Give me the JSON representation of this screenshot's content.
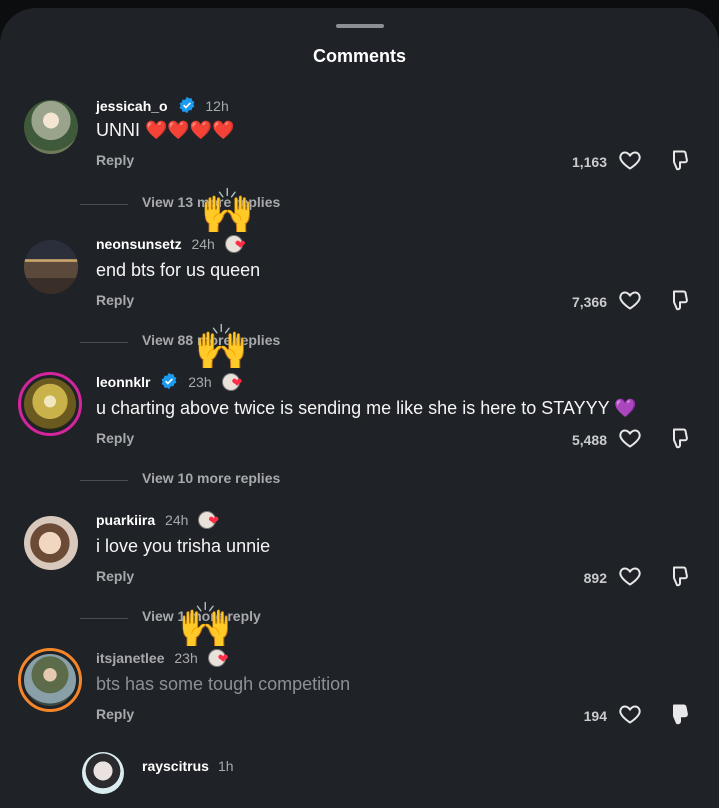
{
  "header": {
    "title": "Comments"
  },
  "reply_label": "Reply",
  "comments": [
    {
      "username": "jessicah_o",
      "verified": true,
      "time": "12h",
      "text": "UNNI ❤️❤️❤️❤️",
      "likes": "1,163",
      "view_more": "View 13 more replies",
      "dim": false
    },
    {
      "username": "neonsunsetz",
      "verified": false,
      "time": "24h",
      "text": "end bts for us queen",
      "likes": "7,366",
      "view_more": "View 88 more replies",
      "dim": false
    },
    {
      "username": "leonnklr",
      "verified": true,
      "time": "23h",
      "text": "u charting above twice is sending me like she is here to STAYYY 💜",
      "likes": "5,488",
      "view_more": "View 10 more replies",
      "dim": false
    },
    {
      "username": "puarkiira",
      "verified": false,
      "time": "24h",
      "text": "i love you trisha unnie",
      "likes": "892",
      "view_more": "View 1 more reply",
      "dim": false
    },
    {
      "username": "itsjanetlee",
      "verified": false,
      "time": "23h",
      "text": "bts has some tough competition",
      "likes": "194",
      "dim": true
    }
  ],
  "next_comment": {
    "username": "rayscitrus",
    "time": "1h"
  },
  "colors": {
    "sheet": "#1f2226",
    "accent_verified": "#1d9bf0",
    "story_ring": "#e1306c"
  },
  "icons": {
    "like": "heart-outline-icon",
    "dislike": "thumbs-down-icon",
    "creator_liked": "creator-heart-badge-icon",
    "overlay": "raising-hands-emoji"
  }
}
